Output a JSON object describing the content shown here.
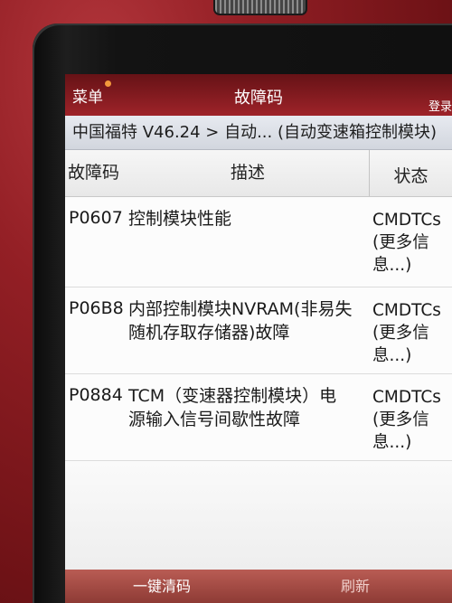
{
  "app": {
    "menu_label": "菜单",
    "title": "故障码",
    "login_label": "登录"
  },
  "breadcrumb": "中国福特 V46.24 > 自动... (自动变速箱控制模块)",
  "table": {
    "headers": {
      "code": "故障码",
      "description": "描述",
      "status": "状态"
    },
    "rows": [
      {
        "code": "P0607",
        "description": [
          "控制模块性能"
        ],
        "status": "CMDTCs",
        "more_info": "(更多信息...)"
      },
      {
        "code": "P06B8",
        "description": [
          "内部控制模块NVRAM(非易失",
          "随机存取存储器)故障"
        ],
        "status": "CMDTCs",
        "more_info": "(更多信息...)"
      },
      {
        "code": "P0884",
        "description": [
          "TCM（变速器控制模块）电",
          "源输入信号间歇性故障"
        ],
        "status": "CMDTCs",
        "more_info": "(更多信息...)"
      }
    ]
  },
  "footer": {
    "clear_codes_label": "一键清码",
    "refresh_label": "刷新"
  },
  "icons": {
    "notification": "notification-dot-icon"
  },
  "colors": {
    "header_bg": "#8b1d22",
    "footer_bg": "#a44a43",
    "breadcrumb_bg": "#dde1e8",
    "notification_dot": "#f39a3c"
  }
}
